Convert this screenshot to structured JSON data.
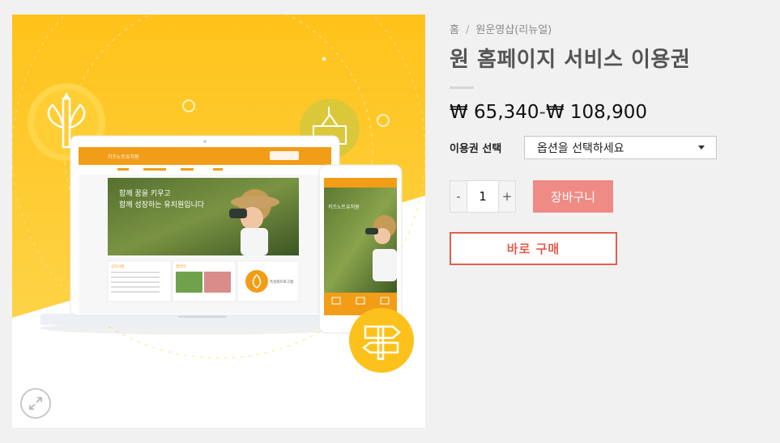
{
  "breadcrumb": {
    "home": "홈",
    "separator": "/",
    "category": "원운영샵(리뉴얼)"
  },
  "product": {
    "title": "원 홈페이지 서비스 이용권",
    "price_min": "₩ 65,340",
    "price_dash": "-",
    "price_max": "₩ 108,900"
  },
  "variation": {
    "label": "이용권 선택",
    "placeholder": "옵션을 선택하세요"
  },
  "quantity": {
    "minus": "-",
    "value": "1",
    "plus": "+"
  },
  "buttons": {
    "add_to_cart": "장바구니",
    "buy_now": "바로 구매"
  },
  "image": {
    "zoom_icon": "expand-icon",
    "mockup_site_name": "키즈노트유치원",
    "mockup_slogan_1": "함께 꿈을 키우고",
    "mockup_slogan_2": "함께 성장하는 유치원입니다",
    "mockup_section_1": "공지사항",
    "mockup_section_2": "갤러리",
    "mockup_section_3": "특성화프로그램"
  },
  "colors": {
    "accent_yellow": "#fcc21b",
    "cart_button": "#f08a84",
    "buy_border": "#e45d4e",
    "mockup_orange": "#f29d17"
  }
}
